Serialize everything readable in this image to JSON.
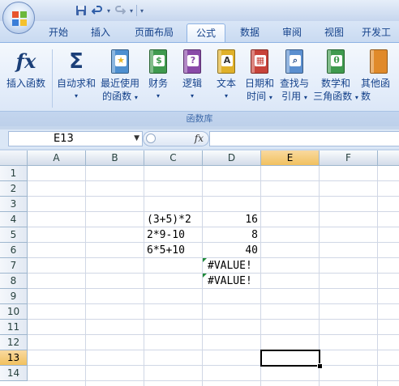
{
  "quick_access": {
    "save_icon": "save-icon",
    "undo_icon": "undo-icon",
    "redo_icon": "redo-icon"
  },
  "tabs": [
    {
      "label": "开始",
      "active": false
    },
    {
      "label": "插入",
      "active": false
    },
    {
      "label": "页面布局",
      "active": false
    },
    {
      "label": "公式",
      "active": true
    },
    {
      "label": "数据",
      "active": false
    },
    {
      "label": "审阅",
      "active": false
    },
    {
      "label": "视图",
      "active": false
    },
    {
      "label": "开发工",
      "active": false
    }
  ],
  "ribbon": {
    "insert_function": {
      "symbol": "fx",
      "label": "插入函数"
    },
    "autosum": {
      "symbol": "Σ",
      "line1": "自动求和",
      "arrow": "▾"
    },
    "recent": {
      "line1": "最近使用",
      "line2": "的函数",
      "arrow": "▾",
      "color": "#4d8fd0",
      "glyph": "★"
    },
    "finance": {
      "line1": "财务",
      "arrow": "▾",
      "color": "#3f9a4e",
      "glyph": "$"
    },
    "logic": {
      "line1": "逻辑",
      "arrow": "▾",
      "color": "#8a4aa8",
      "glyph": "?"
    },
    "text": {
      "line1": "文本",
      "arrow": "▾",
      "color": "#e0b12a",
      "glyph": "A"
    },
    "datetime": {
      "line1": "日期和",
      "line2": "时间",
      "arrow": "▾",
      "color": "#c8433a",
      "glyph": "▦"
    },
    "lookup": {
      "line1": "查找与",
      "line2": "引用",
      "arrow": "▾",
      "color": "#5b8fcf",
      "glyph": "⌕"
    },
    "math": {
      "line1": "数学和",
      "line2": "三角函数",
      "arrow": "▾",
      "color": "#3f9a4e",
      "glyph": "θ"
    },
    "other": {
      "line1": "其他函数",
      "color": "#e08a2a",
      "glyph": ""
    },
    "group_label": "函数库"
  },
  "formula_bar": {
    "name_box": "E13",
    "fx_label": "fx",
    "formula": ""
  },
  "grid": {
    "columns": [
      "A",
      "B",
      "C",
      "D",
      "E",
      "F"
    ],
    "selected_column": "E",
    "rows": [
      "1",
      "2",
      "3",
      "4",
      "5",
      "6",
      "7",
      "8",
      "9",
      "10",
      "11",
      "12",
      "13",
      "14"
    ],
    "selected_row": "13",
    "cells": {
      "C4": "(3+5)*2",
      "D4": "16",
      "C5": "2*9-10",
      "D5": "8",
      "C6": "6*5+10",
      "D6": "40",
      "D7": "#VALUE!",
      "D8": "#VALUE!"
    },
    "active_cell": "E13"
  }
}
